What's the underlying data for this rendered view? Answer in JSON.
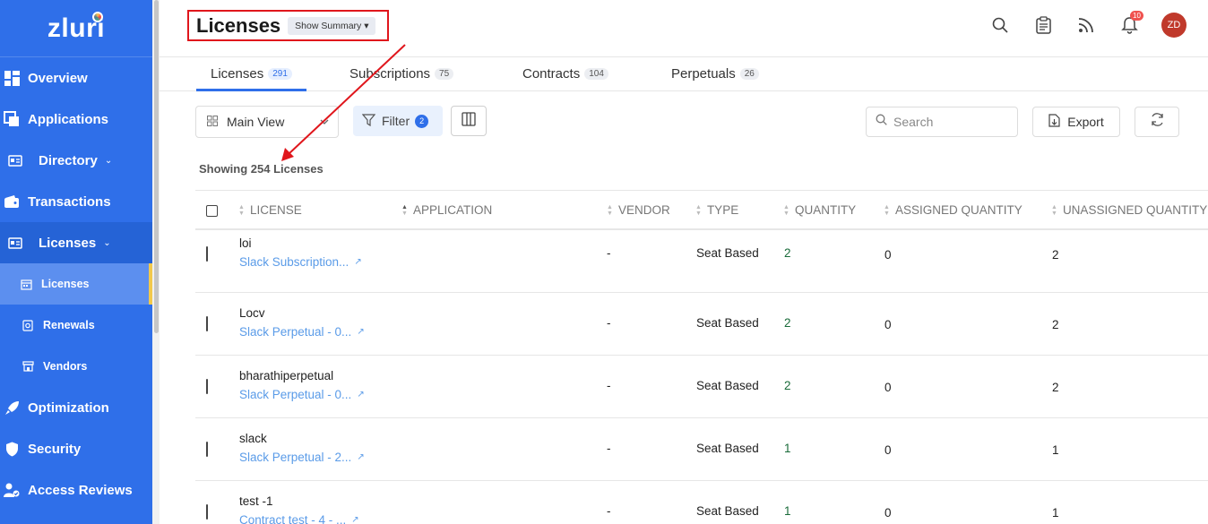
{
  "app": {
    "logo_text": "zluri"
  },
  "sidebar": {
    "items": [
      {
        "label": "Overview",
        "icon": "dashboard-icon"
      },
      {
        "label": "Applications",
        "icon": "applications-icon"
      },
      {
        "label": "Directory",
        "icon": "id-card-icon",
        "has_chevron": true
      },
      {
        "label": "Transactions",
        "icon": "wallet-icon"
      },
      {
        "label": "Licenses",
        "icon": "license-icon",
        "has_chevron": true
      },
      {
        "label": "Optimization",
        "icon": "rocket-icon"
      },
      {
        "label": "Security",
        "icon": "shield-icon"
      },
      {
        "label": "Access Reviews",
        "icon": "user-check-icon"
      }
    ],
    "sub_items": [
      {
        "label": "Licenses",
        "icon": "calendar-icon"
      },
      {
        "label": "Renewals",
        "icon": "renewal-icon"
      },
      {
        "label": "Vendors",
        "icon": "store-icon"
      }
    ],
    "chevron": "⌄"
  },
  "header": {
    "title": "Licenses",
    "summary_label": "Show Summary ▾",
    "notifications_count": "10",
    "avatar_initials": "ZD"
  },
  "tabs": [
    {
      "label": "Licenses",
      "count": "291"
    },
    {
      "label": "Subscriptions",
      "count": "75"
    },
    {
      "label": "Contracts",
      "count": "104"
    },
    {
      "label": "Perpetuals",
      "count": "26"
    }
  ],
  "toolbar": {
    "view_label": "Main View",
    "filter_label": "Filter",
    "filter_count": "2",
    "search_placeholder": "Search",
    "export_label": "Export"
  },
  "summary_text": "Showing 254 Licenses",
  "table": {
    "headers": [
      "LICENSE",
      "APPLICATION",
      "VENDOR",
      "TYPE",
      "QUANTITY",
      "ASSIGNED QUANTITY",
      "UNASSIGNED QUANTITY"
    ],
    "rows": [
      {
        "name": "loi",
        "app": "Slack Subscription...",
        "vendor": "-",
        "type": "Seat Based",
        "quantity": "2",
        "assigned": "0",
        "unassigned": "2"
      },
      {
        "name": "Locv",
        "app": "Slack Perpetual - 0...",
        "vendor": "-",
        "type": "Seat Based",
        "quantity": "2",
        "assigned": "0",
        "unassigned": "2"
      },
      {
        "name": "bharathiperpetual",
        "app": "Slack Perpetual - 0...",
        "vendor": "-",
        "type": "Seat Based",
        "quantity": "2",
        "assigned": "0",
        "unassigned": "2"
      },
      {
        "name": "slack",
        "app": "Slack Perpetual - 2...",
        "vendor": "-",
        "type": "Seat Based",
        "quantity": "1",
        "assigned": "0",
        "unassigned": "1"
      },
      {
        "name": "test -1",
        "app": "Contract test - 4 - ...",
        "vendor": "-",
        "type": "Seat Based",
        "quantity": "1",
        "assigned": "0",
        "unassigned": "1"
      }
    ]
  },
  "colors": {
    "brand": "#2f6fe9",
    "annotation": "#e0161c",
    "link": "#5a9be8"
  }
}
